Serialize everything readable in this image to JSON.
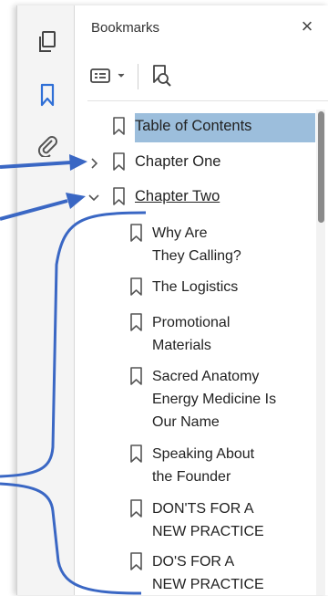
{
  "panel": {
    "title": "Bookmarks",
    "close_glyph": "×"
  },
  "toolbar": {
    "options_icon": "bookmark-options-icon",
    "find_icon": "find-bookmark-icon"
  },
  "sidebar_tools": [
    "pages-icon",
    "bookmark-icon",
    "attachment-icon"
  ],
  "bookmarks": {
    "selected_color": "#9cbedc",
    "items": [
      {
        "label": "Table of Contents",
        "selected": true
      },
      {
        "label": "Chapter One",
        "collapsed": true
      },
      {
        "label": "Chapter Two",
        "expanded": true,
        "children": [
          {
            "line1": "Why Are",
            "line2": "They Calling?"
          },
          {
            "line1": "The Logistics"
          },
          {
            "line1": "Promotional",
            "line2": "Materials"
          },
          {
            "line1": "Sacred Anatomy",
            "line2": "Energy Medicine Is",
            "line3": "Our Name"
          },
          {
            "line1": "Speaking About",
            "line2": "the Founder"
          },
          {
            "line1": "DON'TS FOR A",
            "line2": "NEW PRACTICE"
          },
          {
            "line1": "DO'S FOR A",
            "line2": "NEW PRACTICE"
          }
        ]
      }
    ]
  },
  "annotation_color": "#3a67c4"
}
